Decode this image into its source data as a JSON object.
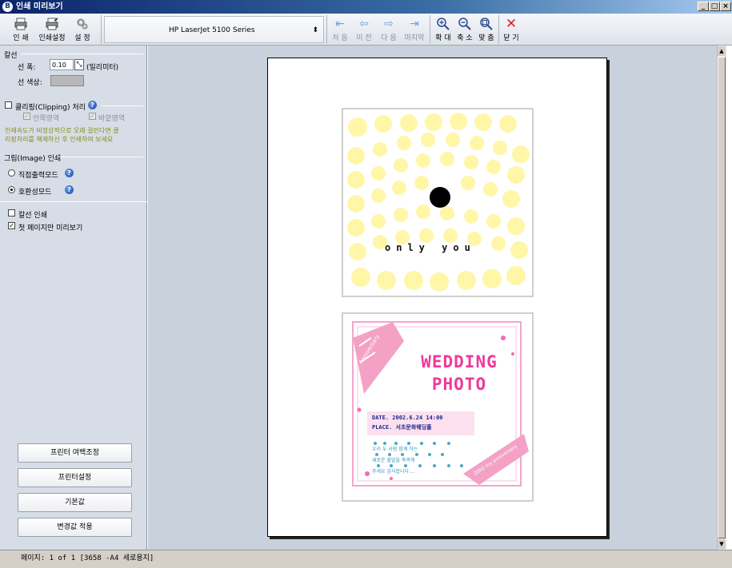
{
  "window": {
    "title": "인쇄 미리보기",
    "app_icon_glyph": "B",
    "controls": [
      "_",
      "□",
      "×"
    ]
  },
  "toolbar": {
    "print": "인 쇄",
    "print_settings": "인쇄설정",
    "settings": "설 정",
    "printer_name": "HP LaserJet 5100 Series",
    "first": "처 음",
    "prev": "이 전",
    "next": "다 음",
    "last": "마지막",
    "zoom_in": "확 대",
    "zoom_out": "축 소",
    "fit": "맞 춤",
    "close": "닫 기"
  },
  "left": {
    "line_section": "칼선",
    "line_width_label": "선 폭:",
    "line_width_value": "0.10",
    "line_width_unit": "(밀리미터)",
    "line_color_label": "선 색상:",
    "line_color": "#b8b8b8",
    "clipping_label": "클리핑(Clipping) 처리",
    "inner_area": "안쪽영역",
    "outer_area": "바깥영역",
    "clipping_note_1": "인쇄속도가 비정상적으로 오래 걸린다면 클",
    "clipping_note_2": "리핑처리를 해제하신 후 인쇄하여 보세요",
    "image_section": "그림(Image) 인쇄",
    "direct_mode": "직접출력모드",
    "compat_mode": "호환성모드",
    "cutline_print": "칼선 인쇄",
    "first_page_only": "첫 페이지만 미리보기",
    "btn_margin": "프린터 여백조정",
    "btn_printer": "프린터설정",
    "btn_default": "기본값",
    "btn_apply": "변경값 적용"
  },
  "preview": {
    "card1_text": "only you",
    "card2_title_1": "WEDDING",
    "card2_title_2": "PHOTO",
    "card2_ribbon_left": "Anniversary",
    "card2_ribbon_right": "2002 my anniversary",
    "card2_date": "DATE. 2002.6.24 14:00",
    "card2_place": "PLACE. 서초문화웨딩홀",
    "card2_message_1": "우리 두 사람 함께 하는",
    "card2_message_2": "새로운 출발을 축복해",
    "card2_message_3": "주세요 감사합니다...."
  },
  "status": {
    "text": "페이지: 1 of 1 [3658 -A4 세로용지]"
  }
}
